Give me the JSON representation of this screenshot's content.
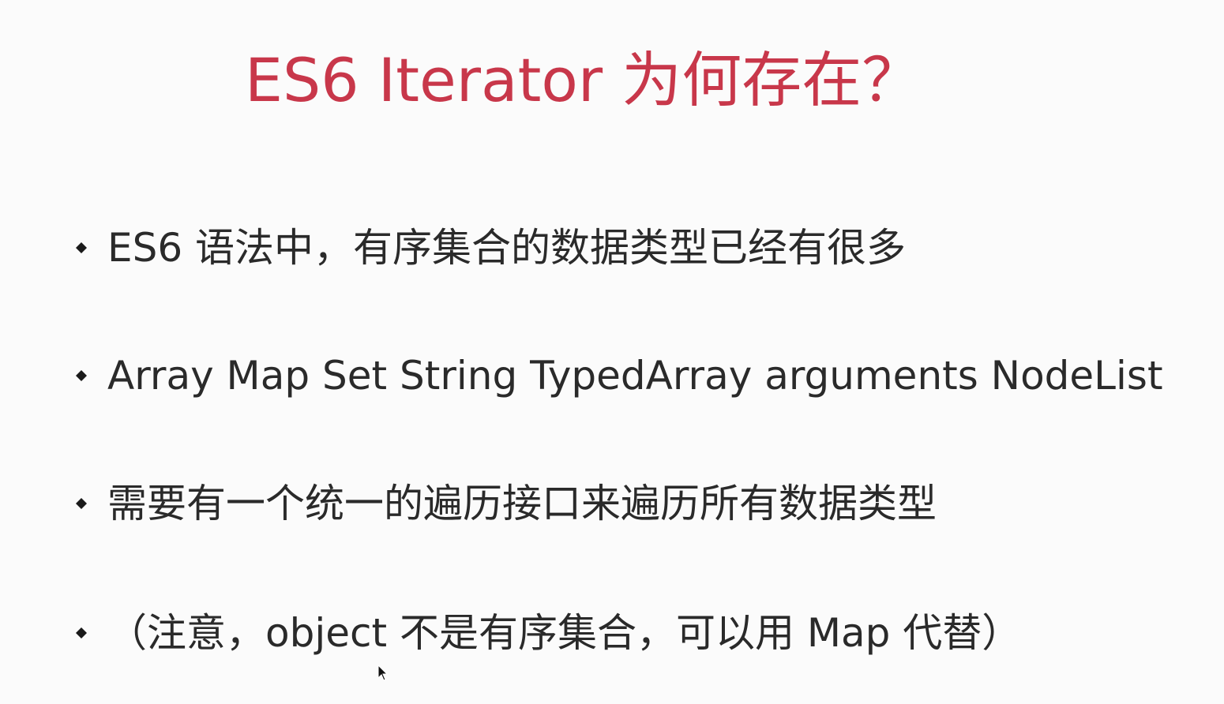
{
  "slide": {
    "title": "ES6 Iterator 为何存在？",
    "title_color": "#c8374a",
    "bullets": [
      "ES6 语法中，有序集合的数据类型已经有很多",
      "Array Map Set String TypedArray arguments NodeList",
      "需要有一个统一的遍历接口来遍历所有数据类型",
      "（注意，object 不是有序集合，可以用 Map 代替）"
    ],
    "bullet_icon": "diamond-bullet-icon",
    "cursor_icon": "mouse-pointer-icon"
  }
}
